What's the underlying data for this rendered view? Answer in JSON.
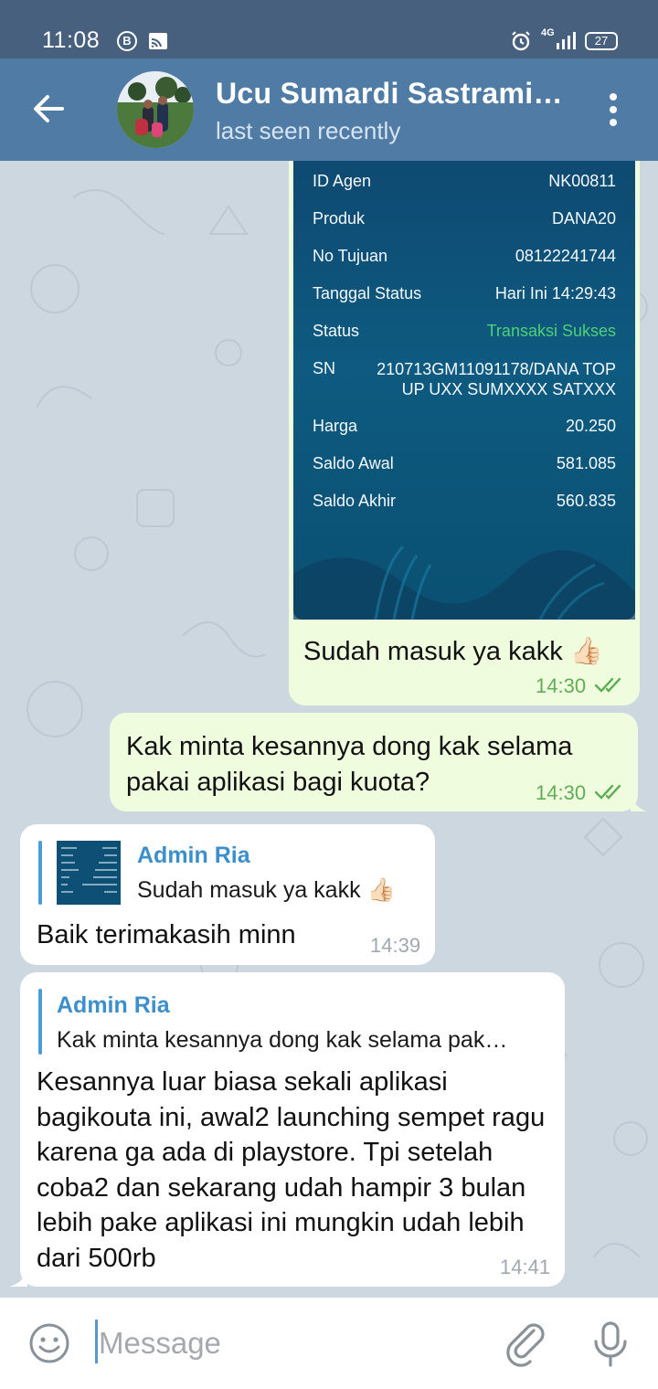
{
  "status_bar": {
    "time": "11:08",
    "app_badge": "B",
    "network": "4G",
    "battery": "27"
  },
  "header": {
    "title": "Ucu Sumardi Sastrami…",
    "subtitle": "last seen recently"
  },
  "receipt": {
    "rows": [
      {
        "label": "ID Agen",
        "value": "NK00811"
      },
      {
        "label": "Produk",
        "value": "DANA20"
      },
      {
        "label": "No Tujuan",
        "value": "08122241744"
      },
      {
        "label": "Tanggal Status",
        "value": "Hari Ini 14:29:43"
      },
      {
        "label": "Status",
        "value": "Transaksi Sukses"
      },
      {
        "label": "SN",
        "value": "210713GM11091178/DANA TOP UP UXX SUMXXXX SATXXX"
      },
      {
        "label": "Harga",
        "value": "20.250"
      },
      {
        "label": "Saldo Awal",
        "value": "581.085"
      },
      {
        "label": "Saldo Akhir",
        "value": "560.835"
      }
    ]
  },
  "messages": [
    {
      "text": "Sudah masuk ya kakk 👍🏻",
      "time": "14:30"
    },
    {
      "text": "Kak minta kesannya dong kak selama pakai aplikasi bagi kuota?",
      "time": "14:30"
    },
    {
      "reply_name": "Admin Ria",
      "reply_text": "Sudah masuk ya kakk 👍🏻",
      "text": "Baik terimakasih minn",
      "time": "14:39"
    },
    {
      "reply_name": "Admin Ria",
      "reply_text": "Kak minta kesannya dong kak selama pak…",
      "text": "Kesannya luar biasa sekali aplikasi bagikouta ini, awal2 launching sempet ragu karena ga ada di playstore. Tpi setelah coba2 dan sekarang udah hampir 3 bulan lebih pake aplikasi ini mungkin udah lebih dari 500rb",
      "time": "14:41"
    }
  ],
  "input": {
    "placeholder": "Message"
  },
  "colors": {
    "header": "#507ba5",
    "statusbar": "#46607d",
    "outgoing_bubble": "#effdde",
    "incoming_bubble": "#ffffff",
    "reply_accent": "#3d8fcc",
    "chat_background": "#ccd7e0"
  }
}
